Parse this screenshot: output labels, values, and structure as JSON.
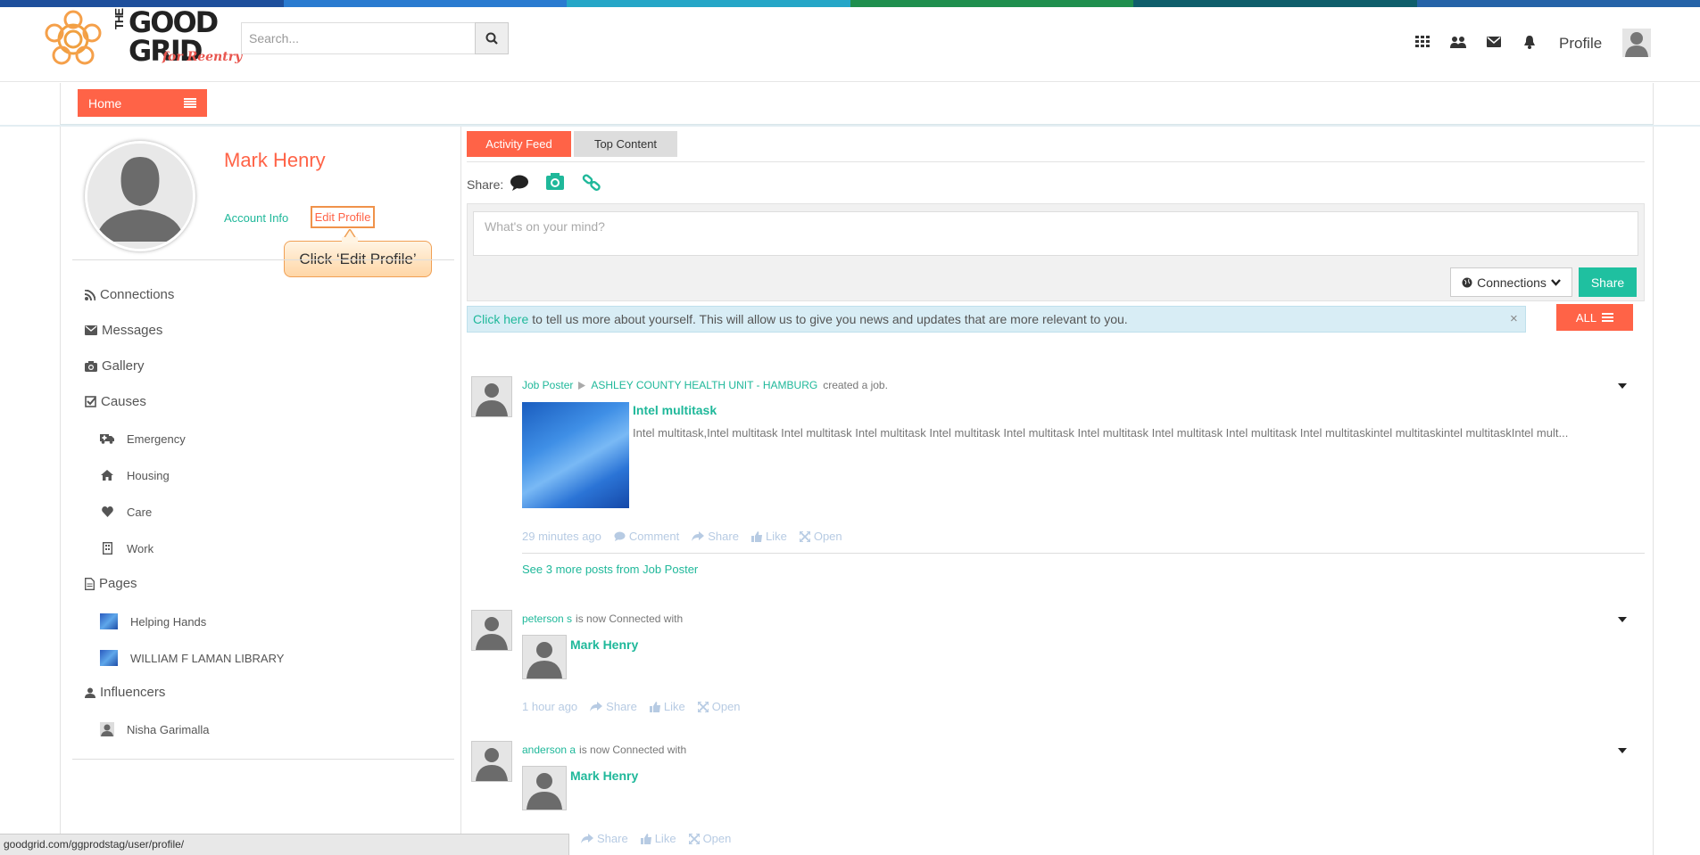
{
  "colors": {
    "accent": "#ff6347",
    "teal": "#1fb89a",
    "top_stripes": [
      "#1e4f9c",
      "#2a7bd0",
      "#25a6c7",
      "#1f8f4e",
      "#0f5e6b",
      "#2563a8"
    ]
  },
  "header": {
    "logo": {
      "line1": "THE",
      "line2": "GOOD",
      "line3": "GRID",
      "tag": "for Reentry"
    },
    "search_placeholder": "Search...",
    "profile_label": "Profile"
  },
  "nav": {
    "home_label": "Home"
  },
  "user": {
    "name": "Mark Henry",
    "account_info": "Account Info",
    "edit_profile": "Edit Profile"
  },
  "callout": "Click ‘Edit Profile’",
  "menu": {
    "connections": "Connections",
    "messages": "Messages",
    "gallery": "Gallery",
    "causes": "Causes",
    "causes_items": [
      "Emergency",
      "Housing",
      "Care",
      "Work"
    ],
    "pages": "Pages",
    "pages_items": [
      "Helping Hands",
      "WILLIAM F LAMAN LIBRARY"
    ],
    "influencers": "Influencers",
    "influencers_items": [
      "Nisha Garimalla"
    ]
  },
  "feed": {
    "tabs": [
      "Activity Feed",
      "Top Content"
    ],
    "share_label": "Share:",
    "composer_placeholder": "What's on your mind?",
    "audience": "Connections",
    "share_button": "Share",
    "alert_link": "Click here",
    "alert_text": "to tell us more about yourself. This will allow us to give you news and updates that are more relevant to you.",
    "alert_close": "×",
    "filter": "ALL"
  },
  "posts": [
    {
      "actor": "Job Poster",
      "target": "ASHLEY COUNTY HEALTH UNIT - HAMBURG",
      "verb": "created a job.",
      "title": "Intel multitask",
      "body": "Intel multitask,Intel multitask Intel multitask Intel multitask Intel multitask Intel multitask Intel multitask Intel multitask Intel multitask  Intel multitaskintel multitaskintel multitaskIntel mult...",
      "time": "29 minutes ago",
      "actions": [
        "Comment",
        "Share",
        "Like",
        "Open"
      ],
      "more": "See 3 more posts from Job Poster"
    },
    {
      "actor": "peterson s",
      "verb": "is now Connected with",
      "connected": "Mark Henry",
      "time": "1 hour ago",
      "actions": [
        "Share",
        "Like",
        "Open"
      ]
    },
    {
      "actor": "anderson a",
      "verb": "is now Connected with",
      "connected": "Mark Henry",
      "actions": [
        "Share",
        "Like",
        "Open"
      ]
    }
  ],
  "statusbar": "goodgrid.com/ggprodstag/user/profile/"
}
